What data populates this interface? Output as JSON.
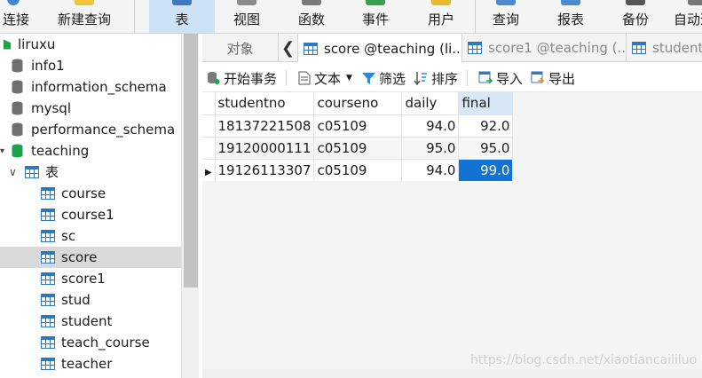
{
  "toolbar": {
    "items": [
      {
        "label": "连接",
        "icon": "connect-icon"
      },
      {
        "label": "新建查询",
        "icon": "new-query-icon"
      },
      {
        "label": "表",
        "icon": "table-icon",
        "active": true
      },
      {
        "label": "视图",
        "icon": "view-icon"
      },
      {
        "label": "函数",
        "icon": "function-icon"
      },
      {
        "label": "事件",
        "icon": "event-icon"
      },
      {
        "label": "用户",
        "icon": "user-icon"
      },
      {
        "label": "查询",
        "icon": "query-icon"
      },
      {
        "label": "报表",
        "icon": "report-icon"
      },
      {
        "label": "备份",
        "icon": "backup-icon"
      },
      {
        "label": "自动运",
        "icon": "automation-icon"
      }
    ]
  },
  "sidebar": {
    "connection": "liruxu",
    "databases": [
      "info1",
      "information_schema",
      "mysql",
      "performance_schema",
      "teaching"
    ],
    "tables_group": "表",
    "tables": [
      "course",
      "course1",
      "sc",
      "score",
      "score1",
      "stud",
      "student",
      "teach_course",
      "teacher"
    ],
    "selected_table": "score"
  },
  "tabs": {
    "objects_label": "对象",
    "items": [
      {
        "label": "score @teaching (li...",
        "active": true
      },
      {
        "label": "score1 @teaching (...",
        "active": false
      },
      {
        "label": "student",
        "active": false
      }
    ]
  },
  "subtoolbar": {
    "begin_transaction": "开始事务",
    "text": "文本",
    "filter": "筛选",
    "sort": "排序",
    "import": "导入",
    "export": "导出"
  },
  "grid": {
    "columns": [
      "studentno",
      "courseno",
      "daily",
      "final"
    ],
    "rows": [
      [
        "18137221508",
        "c05109",
        "94.0",
        "92.0"
      ],
      [
        "19120000111",
        "c05109",
        "95.0",
        "95.0"
      ],
      [
        "19126113307",
        "c05109",
        "94.0",
        "99.0"
      ]
    ]
  },
  "watermark": "https://blog.csdn.net/xiaotiancaililuo",
  "colors": {
    "accent": "#1173d4",
    "selected_header": "#d8e8f6",
    "db_active": "#1fa34a",
    "db_icon": "#6f6f6f",
    "table_icon": "#2e78c2"
  }
}
